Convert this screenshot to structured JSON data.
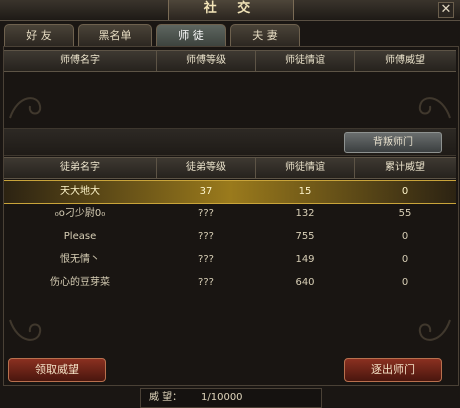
{
  "window": {
    "title": "社 交",
    "close_icon": "close-icon"
  },
  "tabs": [
    {
      "label": "好 友",
      "active": false
    },
    {
      "label": "黑名单",
      "active": false
    },
    {
      "label": "师 徒",
      "active": true
    },
    {
      "label": "夫 妻",
      "active": false
    }
  ],
  "master_table": {
    "headers": [
      "师傅名字",
      "师傅等级",
      "师徒情谊",
      "师傅威望"
    ],
    "rows": []
  },
  "betray_button": "背叛师门",
  "disciple_table": {
    "headers": [
      "徒弟名字",
      "徒弟等级",
      "师徒情谊",
      "累计威望"
    ],
    "rows": [
      {
        "name": "天大地大",
        "level": "37",
        "bond": "15",
        "prestige": "0",
        "selected": true
      },
      {
        "name": "₀o刁少尉0₀",
        "level": "???",
        "bond": "132",
        "prestige": "55",
        "selected": false
      },
      {
        "name": "Please",
        "level": "???",
        "bond": "755",
        "prestige": "0",
        "selected": false
      },
      {
        "name": "恨无情丶",
        "level": "???",
        "bond": "149",
        "prestige": "0",
        "selected": false
      },
      {
        "name": "伤心的豆芽菜",
        "level": "???",
        "bond": "640",
        "prestige": "0",
        "selected": false
      }
    ]
  },
  "claim_button": "领取威望",
  "expel_button": "逐出师门",
  "footer": {
    "prestige_label": "威 望：",
    "prestige_value": "1/10000"
  }
}
